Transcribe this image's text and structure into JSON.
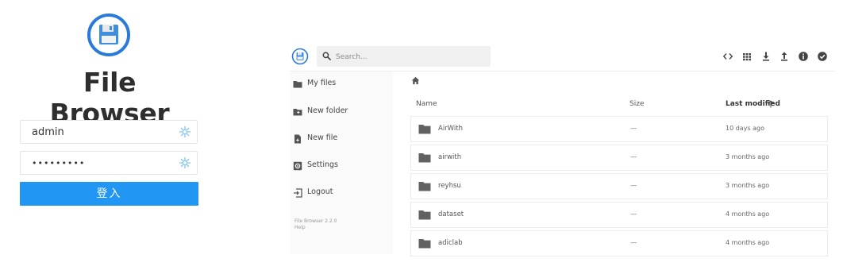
{
  "login": {
    "title": "File Browser",
    "username_value": "admin",
    "password_value": "•••••••••",
    "submit_label": "登入"
  },
  "header": {
    "search_placeholder": "Search...",
    "icons": [
      "code-icon",
      "grid-view-icon",
      "download-icon",
      "upload-icon",
      "info-icon",
      "check-circle-icon"
    ]
  },
  "sidebar": {
    "items": [
      {
        "label": "My files",
        "icon": "folder-icon"
      },
      {
        "label": "New folder",
        "icon": "new-folder-icon"
      },
      {
        "label": "New file",
        "icon": "new-file-icon"
      },
      {
        "label": "Settings",
        "icon": "settings-icon"
      },
      {
        "label": "Logout",
        "icon": "logout-icon"
      }
    ],
    "footer_version": "File Browser 2.2.0",
    "footer_help": "Help"
  },
  "listing": {
    "columns": {
      "name": "Name",
      "size": "Size",
      "modified": "Last modified"
    },
    "rows": [
      {
        "name": "AirWith",
        "size": "—",
        "modified": "10 days ago"
      },
      {
        "name": "airwith",
        "size": "—",
        "modified": "3 months ago"
      },
      {
        "name": "reyhsu",
        "size": "—",
        "modified": "3 months ago"
      },
      {
        "name": "dataset",
        "size": "—",
        "modified": "4 months ago"
      },
      {
        "name": "adiclab",
        "size": "—",
        "modified": "4 months ago"
      }
    ]
  },
  "colors": {
    "accent": "#2196f3",
    "icon_gray": "#555555"
  }
}
